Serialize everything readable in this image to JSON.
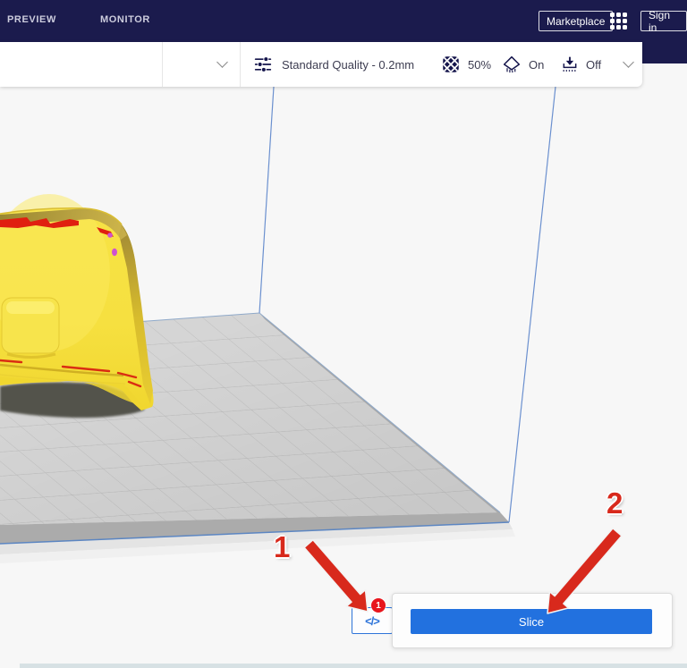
{
  "header": {
    "tabs": [
      {
        "label": "PREVIEW"
      },
      {
        "label": "MONITOR"
      }
    ],
    "marketplace_label": "Marketplace",
    "sign_in_label": "Sign in"
  },
  "toolbar": {
    "profile_label": "Standard Quality - 0.2mm",
    "infill_value": "50%",
    "support_value": "On",
    "adhesion_value": "Off"
  },
  "action_panel": {
    "slice_label": "Slice",
    "gcode_icon": "</>",
    "badge_count": "1"
  },
  "annotations": {
    "step1": "1",
    "step2": "2"
  },
  "colors": {
    "header_navy": "#1b1b4d",
    "accent_blue": "#2271df",
    "badge_red": "#e8151d",
    "arrow_red": "#d8291c",
    "model_yellow": "#f5df3a",
    "build_plate_gray": "#d5d5d5",
    "build_volume_blue": "#6b90cf"
  }
}
